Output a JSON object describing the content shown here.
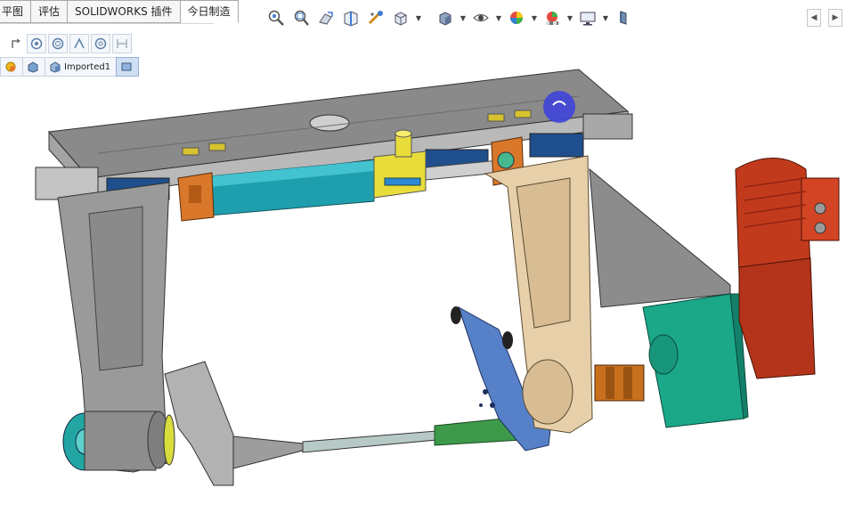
{
  "tabs": [
    {
      "label": "平图",
      "visible_label": "平图"
    },
    {
      "label": "评估"
    },
    {
      "label": "SOLIDWORKS 插件"
    },
    {
      "label": "今日制造"
    }
  ],
  "breadcrumb": {
    "items": [
      {
        "icon": "assembly-icon",
        "label": ""
      },
      {
        "icon": "part-icon",
        "label": ""
      },
      {
        "icon": "imported-part-icon",
        "label": "Imported1"
      },
      {
        "icon": "face-icon",
        "label": ""
      }
    ]
  },
  "toolbar": {
    "items": [
      "zoom-to-fit-icon",
      "zoom-to-area-icon",
      "previous-view-icon",
      "section-view-icon",
      "dynamic-annotation-icon",
      "view-orientation-icon",
      "display-style-icon",
      "hide-show-icon",
      "edit-appearance-icon",
      "apply-scene-icon",
      "view-settings-icon",
      "rotate-view-icon"
    ]
  },
  "colors": {
    "frame_gray": "#9a9a9a",
    "plate_top": "#7d7d7d",
    "cylinder_teal": "#1f9fae",
    "cylinder_yellow": "#e8dc3a",
    "motor_red": "#c23a1c",
    "gearbox_green": "#1aa889",
    "bracket_tan": "#e7cfaa",
    "plate_blue": "#5680c8",
    "bracket_orange": "#d9772a",
    "rod_green": "#3d9a4a"
  }
}
